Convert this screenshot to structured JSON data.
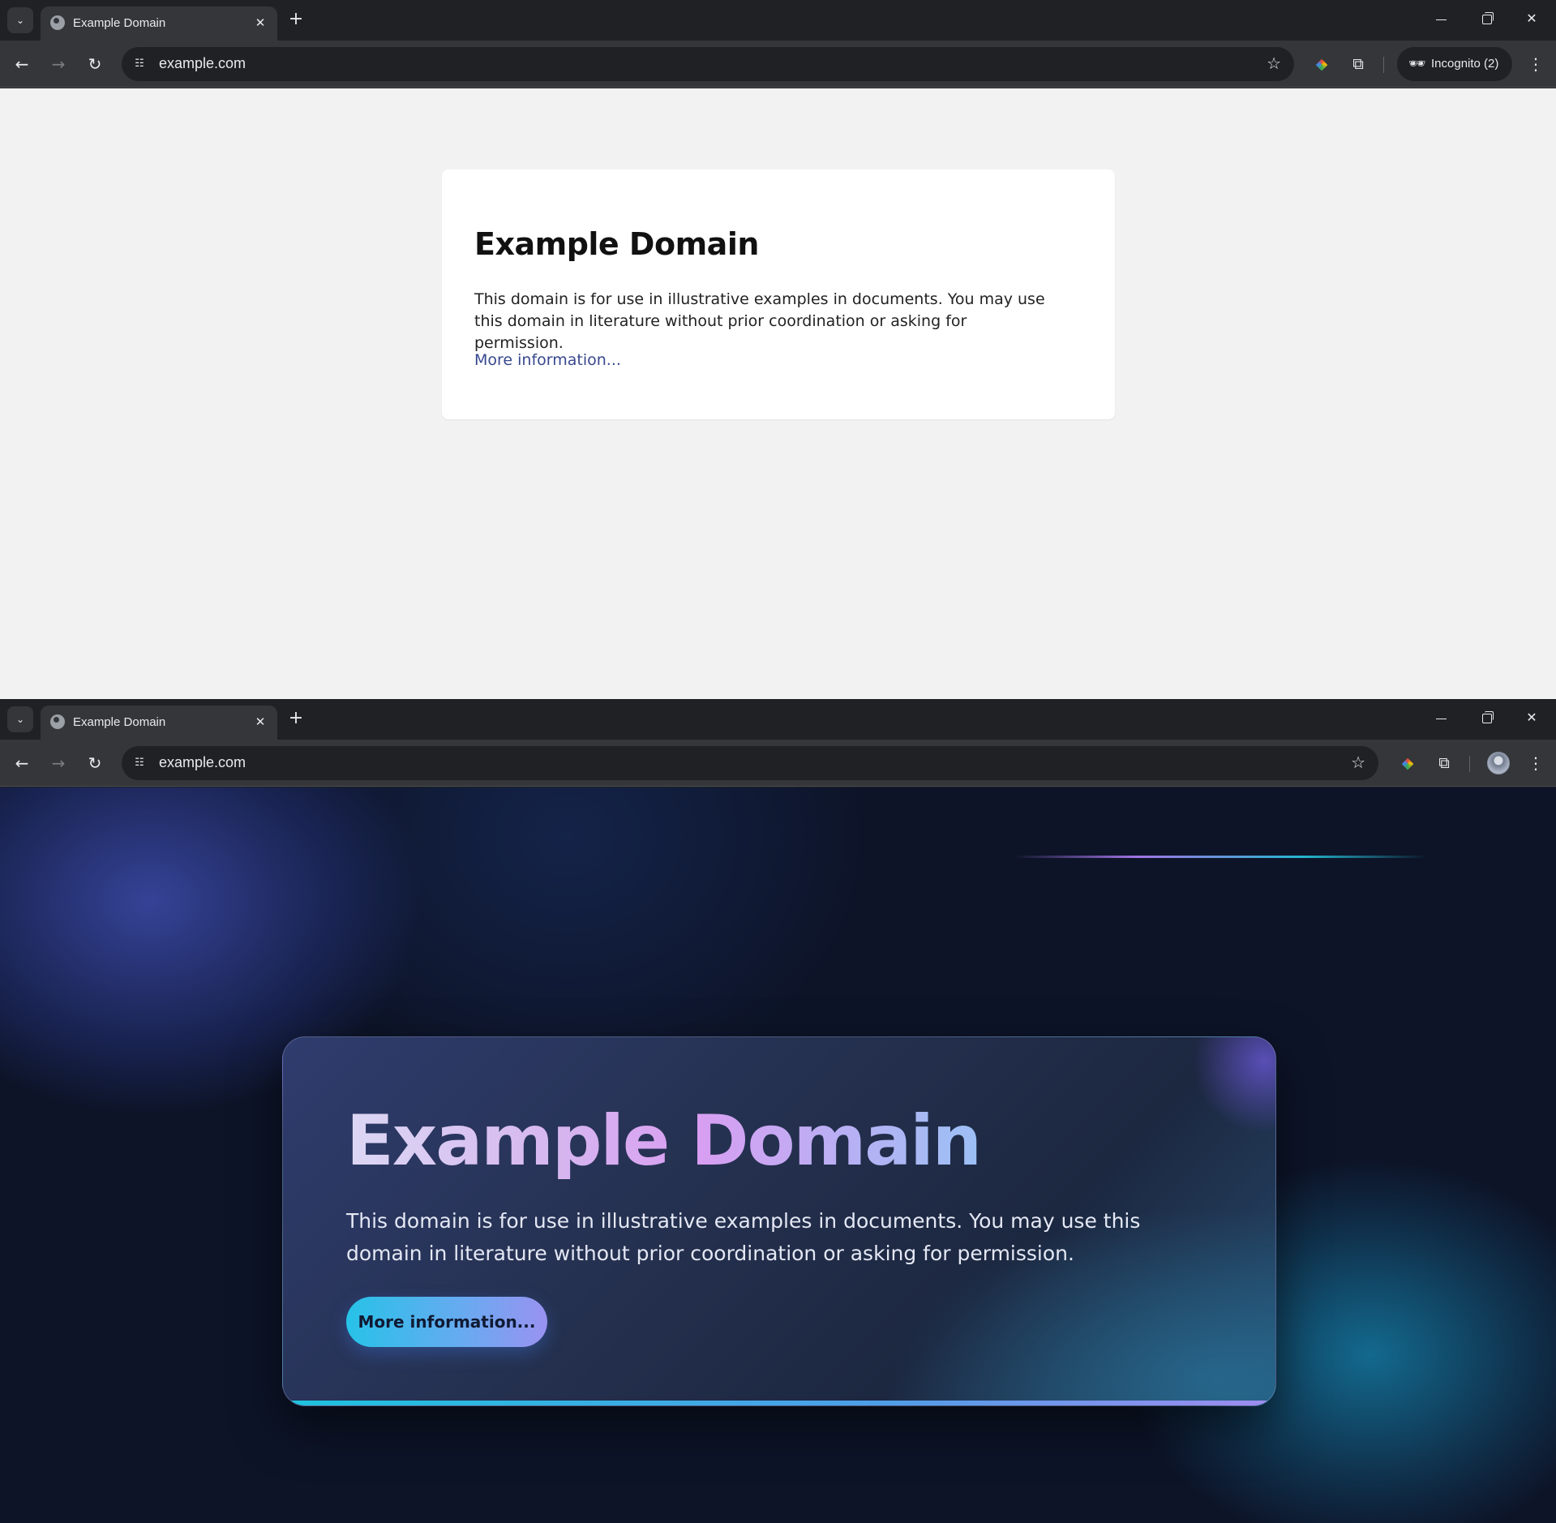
{
  "windows": [
    {
      "tab": {
        "title": "Example Domain",
        "close": "✕"
      },
      "omnibox": {
        "url": "example.com"
      },
      "profile": {
        "label": "Incognito (2)"
      },
      "page": {
        "heading": "Example Domain",
        "body": "This domain is for use in illustrative examples in documents. You may use this domain in literature without prior coordination or asking for permission.",
        "link": "More information..."
      }
    },
    {
      "tab": {
        "title": "Example Domain",
        "close": "✕"
      },
      "omnibox": {
        "url": "example.com"
      },
      "page": {
        "heading": "Example Domain",
        "body": "This domain is for use in illustrative examples in documents. You may use this domain in literature without prior coordination or asking for permission.",
        "button": "More information..."
      }
    }
  ],
  "icons": {
    "tab_list": "⌄",
    "new_tab": "+",
    "back": "←",
    "forward": "→",
    "reload": "↻",
    "site_settings": "☷",
    "bookmark": "☆",
    "extensions": "⧉",
    "menu": "⋮",
    "incognito": "🕶",
    "close_window": "✕"
  },
  "colors": {
    "chrome_dark": "#202124",
    "toolbar": "#35363a",
    "page1_bg": "#f2f2f2",
    "page1_link": "#38488f",
    "page2_bg": "#0d1428",
    "accent_cyan": "#1ec3de",
    "accent_violet": "#a08cf0"
  }
}
